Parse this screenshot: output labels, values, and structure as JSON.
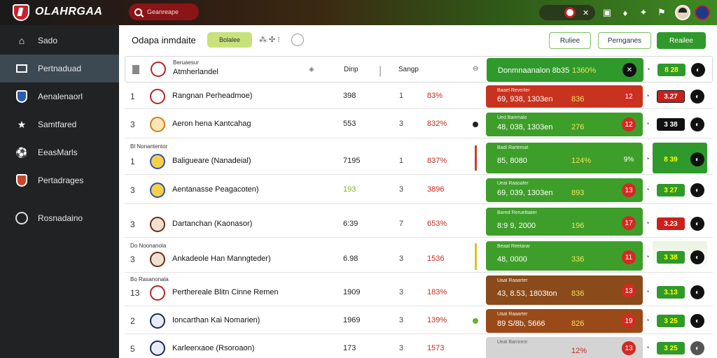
{
  "app": {
    "brand": "OLAHRGAA"
  },
  "search": {
    "placeholder": "Geanreape"
  },
  "topbar": {
    "close_glyph": "✕"
  },
  "sidebar": {
    "items": [
      {
        "label": "Sado",
        "icon": "home-icon"
      },
      {
        "label": "Pertnaduad",
        "icon": "list-icon"
      },
      {
        "label": "Aenalenaorl",
        "icon": "shield-icon"
      },
      {
        "label": "Samtfared",
        "icon": "star-icon"
      },
      {
        "label": "EeasMarls",
        "icon": "ball-icon"
      },
      {
        "label": "Pertadrages",
        "icon": "crest-icon"
      },
      {
        "label": "Rosnadaino",
        "icon": "clock-icon"
      }
    ]
  },
  "subbar": {
    "title": "Odapa inmdaite",
    "chip": "Bolalee",
    "tools": "⁂ ✣ ⁝",
    "btn_1": "Ruliee",
    "btn_2": "Pernganes",
    "btn_3": "Reailee"
  },
  "header_row": {
    "top_label": "Beruaesur",
    "name": "Atmherlandel",
    "col_2": "Dinp",
    "col_4": "Sangp",
    "stat_line": "Donmnaanalon 8b35",
    "stat_pct": "1360%",
    "stat_badge": "✕",
    "tag": "8 28"
  },
  "rows": [
    {
      "rank": "1",
      "sublabel": "",
      "team": "Rangnan Perheadmoe)",
      "num": "398",
      "col": "1",
      "pct": "83%",
      "stat_title": "Baael Reverter",
      "stat_line": "69, 938, 1303en",
      "stat_pct": "836",
      "badge": "12",
      "tag": "3.27"
    },
    {
      "rank": "3",
      "sublabel": "",
      "team": "Aeron hena Kantcahag",
      "num": "553",
      "col": "3",
      "pct": "832%",
      "stat_title": "Ued Barimalo",
      "stat_line": "48, 038, 1303en",
      "stat_pct": "276",
      "badge": "12",
      "tag": "3 38"
    },
    {
      "rank": "1",
      "sublabel": "Bl Nonantentor",
      "team": "Baligueare (Nanadeial)",
      "num": "7195",
      "col": "1",
      "pct": "837%",
      "stat_title": "Badl Rarlemat",
      "stat_line": "85, 8080",
      "stat_pct": "124%",
      "badge": "9%",
      "tag": "8 39"
    },
    {
      "rank": "3",
      "sublabel": "",
      "team": "Aentanasse Peagacoten)",
      "num": "193",
      "col": "3",
      "pct": "3896",
      "stat_title": "Ueal Raasafer",
      "stat_line": "69, 039, 1303en",
      "stat_pct": "893",
      "badge": "13",
      "tag": "3 27"
    },
    {
      "rank": "3",
      "sublabel": "",
      "team": "Dartanchan (Kaonasor)",
      "num": "6:39",
      "col": "7",
      "pct": "653%",
      "stat_title": "Bared Rerueltiater",
      "stat_line": "8:9 9, 2000",
      "stat_pct": "196",
      "badge": "17",
      "tag": "3.23"
    },
    {
      "rank": "3",
      "sublabel": "Do Noonanola",
      "team": "Ankadeole Han Manngteder)",
      "num": "6.98",
      "col": "3",
      "pct": "1536",
      "stat_title": "Beaal Reetarar",
      "stat_line": "48, 0000",
      "stat_pct": "336",
      "badge": "11",
      "tag": "3 38"
    },
    {
      "rank": "13",
      "sublabel": "Bo Rasanonala",
      "team": "Perthereale Blitn Cinne Remen",
      "num": "1909",
      "col": "3",
      "pct": "183%",
      "stat_title": "Uaal Raaarter",
      "stat_line": "43, 8.53, 1803ton",
      "stat_pct": "836",
      "badge": "13",
      "tag": "3.13"
    },
    {
      "rank": "2",
      "sublabel": "",
      "team": "Ioncarthan Kai Nomarien)",
      "num": "1969",
      "col": "3",
      "pct": "139%",
      "stat_title": "Uaal Raaarter",
      "stat_line": "89 S/8b, 5666",
      "stat_pct": "826",
      "badge": "19",
      "tag": "3 25"
    },
    {
      "rank": "5",
      "sublabel": "",
      "team": "Karleerxaoe (Rsoroaon)",
      "num": "173",
      "col": "3",
      "pct": "1573",
      "stat_title": "Ueal Barrirenr",
      "stat_line": "",
      "stat_pct": "12%",
      "badge": "13",
      "tag": "3 25"
    }
  ]
}
